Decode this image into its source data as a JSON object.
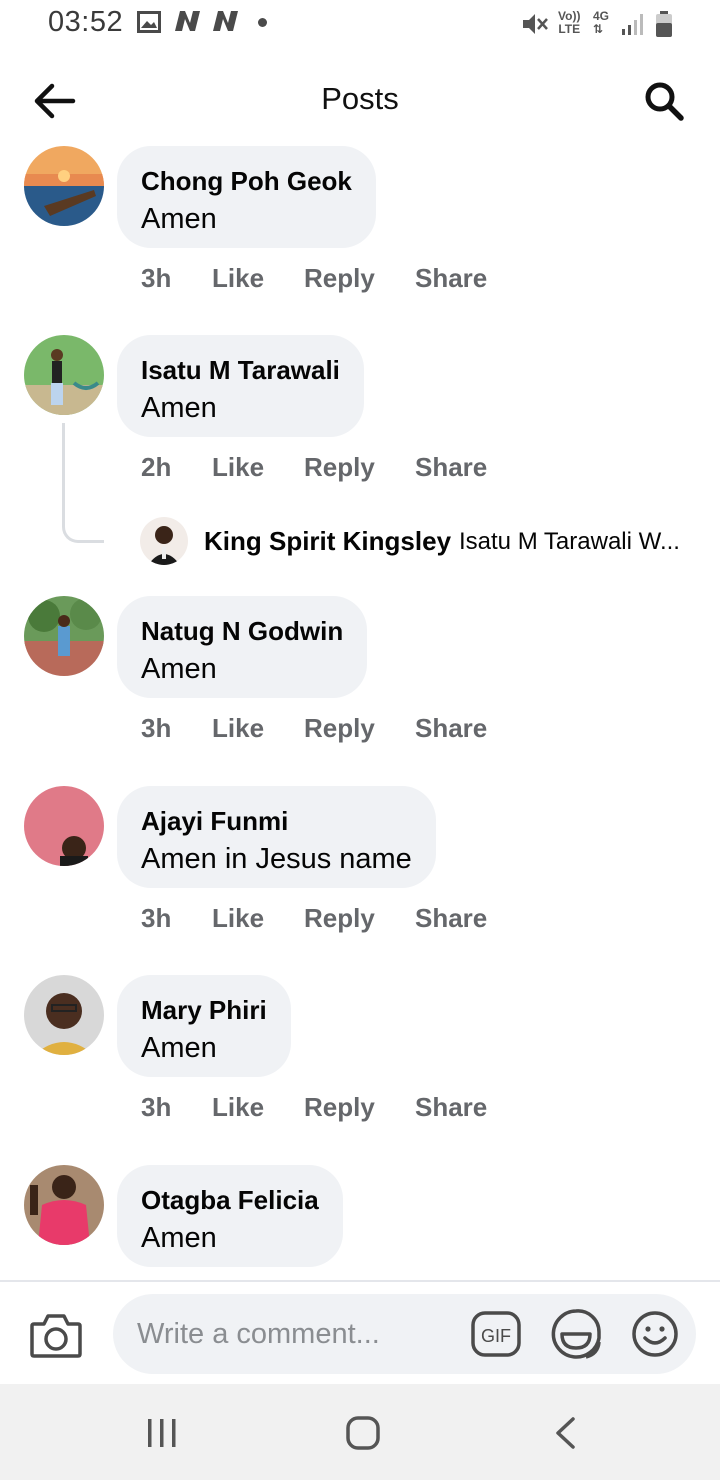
{
  "status_bar": {
    "time": "03:52",
    "volte_top": "Vo))",
    "volte_bottom": "LTE",
    "network": "4G",
    "icons": [
      "gallery-icon",
      "n-icon",
      "n-icon",
      "dot-icon",
      "mute-icon",
      "signal-icon",
      "battery-icon"
    ]
  },
  "header": {
    "title": "Posts",
    "back_icon": "arrow-left-icon",
    "search_icon": "search-icon"
  },
  "comments": [
    {
      "author": "Chong Poh Geok",
      "text": "Amen",
      "time": "3h",
      "like": "Like",
      "reply": "Reply",
      "share": "Share"
    },
    {
      "author": "Isatu M Tarawali",
      "text": "Amen",
      "time": "2h",
      "like": "Like",
      "reply": "Reply",
      "share": "Share"
    },
    {
      "author": "Natug N Godwin",
      "text": "Amen",
      "time": "3h",
      "like": "Like",
      "reply": "Reply",
      "share": "Share"
    },
    {
      "author": "Ajayi Funmi",
      "text": "Amen in Jesus name",
      "time": "3h",
      "like": "Like",
      "reply": "Reply",
      "share": "Share"
    },
    {
      "author": "Mary Phiri",
      "text": "Amen",
      "time": "3h",
      "like": "Like",
      "reply": "Reply",
      "share": "Share"
    },
    {
      "author": "Otagba Felicia",
      "text": "Amen"
    }
  ],
  "reply": {
    "author": "King Spirit Kingsley",
    "text": "Isatu M Tarawali W..."
  },
  "composer": {
    "placeholder": "Write a comment...",
    "gif_label": "GIF"
  },
  "colors": {
    "bubble": "#f0f2f5",
    "meta_text": "#65676b",
    "primary_text": "#050505"
  }
}
